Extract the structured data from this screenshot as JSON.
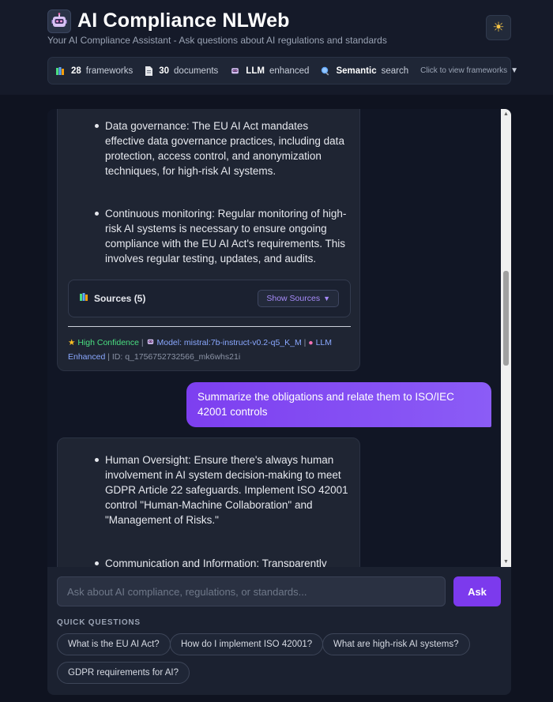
{
  "header": {
    "title": "AI Compliance NLWeb",
    "subtitle": "Your AI Compliance Assistant - Ask questions about AI regulations and standards",
    "theme_icon": "sun-icon"
  },
  "stats": {
    "frameworks_count": "28",
    "frameworks_label": "frameworks",
    "documents_count": "30",
    "documents_label": "documents",
    "llm_strong": "LLM",
    "llm_label": "enhanced",
    "semantic_strong": "Semantic",
    "semantic_label": "search",
    "view_frameworks": "Click to view frameworks"
  },
  "messages": {
    "bot1": {
      "bullets": [
        "Data governance: The EU AI Act mandates effective data governance practices, including data protection, access control, and anonymization techniques, for high-risk AI systems.",
        "Continuous monitoring: Regular monitoring of high-risk AI systems is necessary to ensure ongoing compliance with the EU AI Act's requirements. This involves regular testing, updates, and audits."
      ],
      "sources_label": "Sources (5)",
      "show_sources": "Show Sources",
      "confidence": "High Confidence",
      "model": "Model: mistral:7b-instruct-v0.2-q5_K_M",
      "llm": "LLM Enhanced",
      "id": "ID: q_1756752732566_mk6whs21i"
    },
    "user1": {
      "text": "Summarize the obligations and relate them to ISO/IEC 42001 controls"
    },
    "bot2": {
      "bullets": [
        "Human Oversight: Ensure there's always human involvement in AI system decision-making to meet GDPR Article 22 safeguards. Implement ISO 42001 control \"Human-Machine Collaboration\" and \"Management of Risks.\"",
        "Communication and Information: Transparently"
      ]
    }
  },
  "input": {
    "placeholder": "Ask about AI compliance, regulations, or standards...",
    "ask_label": "Ask"
  },
  "quick_questions": {
    "label": "QUICK QUESTIONS",
    "items": [
      "What is the EU AI Act?",
      "How do I implement ISO 42001?",
      "What are high-risk AI systems?",
      "GDPR requirements for AI?"
    ]
  },
  "colors": {
    "accent": "#7c3aed",
    "background": "#0f1320",
    "confidence": "#4ade80",
    "link": "#8aa8ff"
  }
}
